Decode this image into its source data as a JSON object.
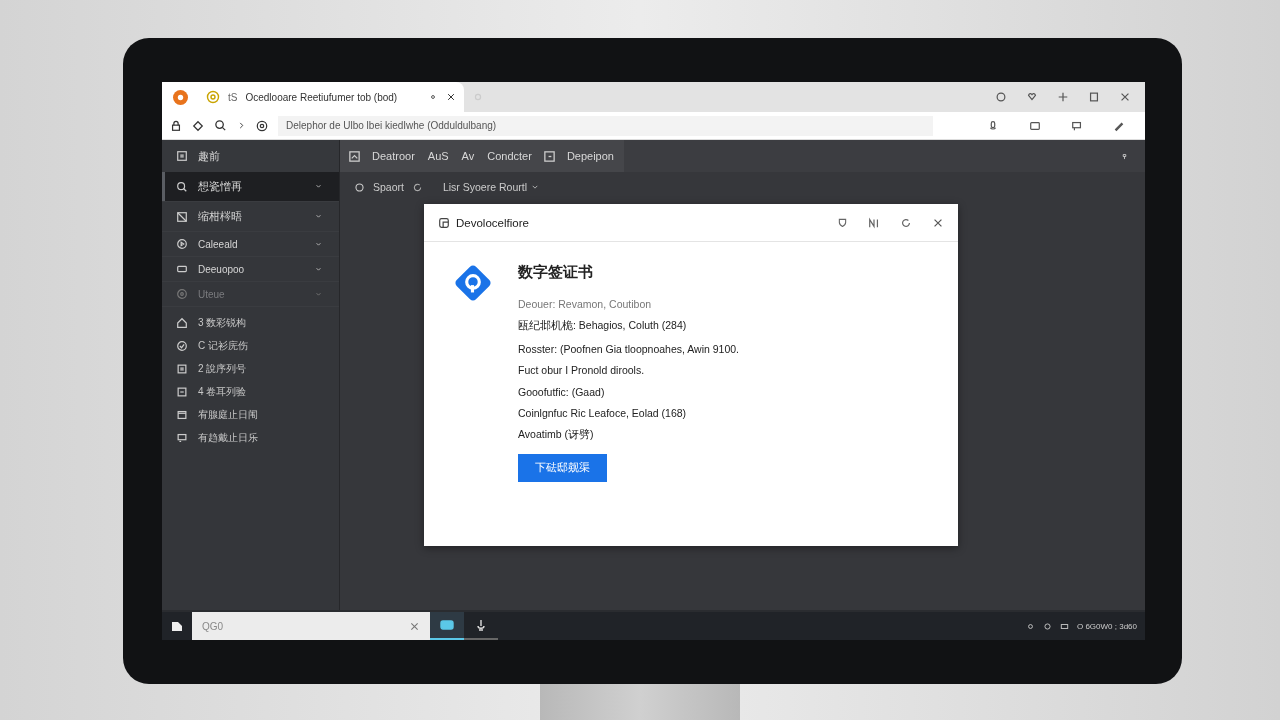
{
  "browser": {
    "tabs": [
      {
        "prefix": "tS",
        "title": "Ocedlooare Reetiufumer tob (bod)",
        "selected": true
      },
      {
        "selected": false
      }
    ],
    "address": "Delephor de Ulbo lbei kiedIwhe (Odduldulbang)"
  },
  "app": {
    "sidebar_title": "趣前",
    "toolbar": [
      {
        "label": "Deatroor"
      },
      {
        "label": "AuS"
      },
      {
        "label": "Av"
      },
      {
        "label": "Condcter"
      },
      {
        "label": "Depeipon"
      }
    ],
    "sidebar": {
      "groups": [
        {
          "label": "想瓷憎再",
          "selected": true,
          "disabled": false
        },
        {
          "label": "缩柑梣晤",
          "selected": false,
          "disabled": false
        },
        {
          "label": "Caleeald",
          "selected": false,
          "disabled": false
        },
        {
          "label": "Deeuopoo",
          "selected": false,
          "disabled": false
        },
        {
          "label": "Uteue",
          "selected": false,
          "disabled": true
        }
      ],
      "items": [
        "3 数彩锐构",
        "C 记衫庑伤",
        "2 說序列号",
        "4 卷耳列验",
        "宥腺庭止日闱",
        "有趋戴止日乐"
      ]
    },
    "filter": {
      "label": "Spaort",
      "dropdown": "Lisr Syoere Rourtl"
    }
  },
  "dialog": {
    "title": "Devolocelfiore",
    "heading": "数字签证书",
    "lines": [
      {
        "text": "Deouer:  Revamon, Coutibon",
        "muted": true
      },
      {
        "text": "瓯纪邶机桅:  Behagios, Coluth (284)",
        "muted": false
      },
      {
        "text": "Rosster:  (Poofnen Gia tloopnoahes, Awin 9100.",
        "muted": false
      },
      {
        "text": "Fuct obur I Pronold dirools.",
        "muted": false
      },
      {
        "text": "Gooofutfic:  (Gaad)",
        "muted": false
      },
      {
        "text": "Coinlgnfuc Ric Leafoce, Eolad (168)",
        "muted": false
      },
      {
        "text": "Avoatimb (讶劈)",
        "muted": false
      }
    ],
    "button": "下砝邸觌渠"
  },
  "taskbar": {
    "search_placeholder": "QG0",
    "apps": [
      {
        "selected": true
      },
      {
        "selected": false
      }
    ],
    "tray_text": "O 6G0W0 ; 3d60"
  }
}
